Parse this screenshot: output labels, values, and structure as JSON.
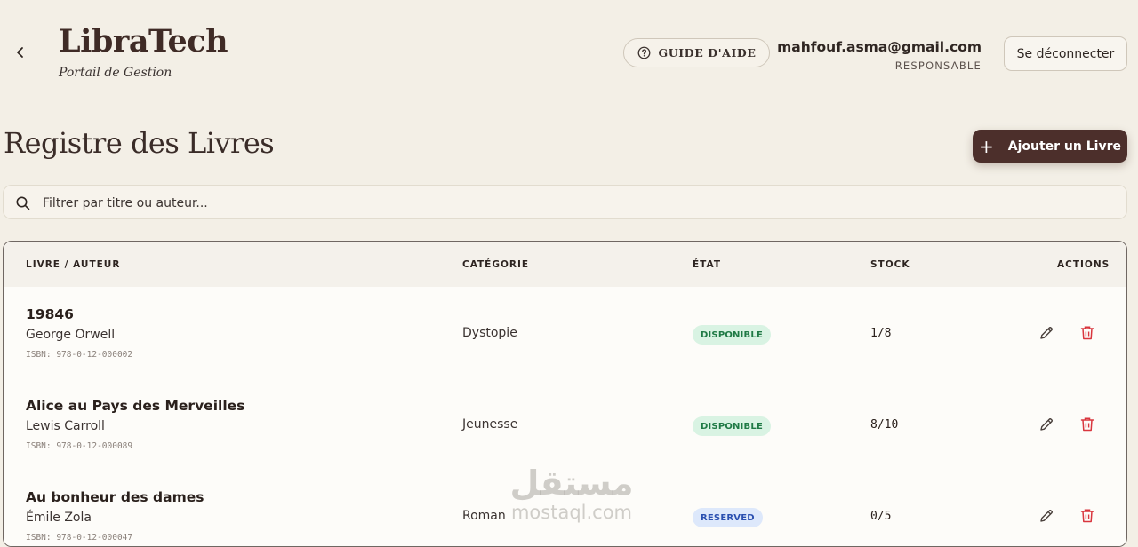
{
  "header": {
    "logo": "LibraTech",
    "subtitle": "Portail de Gestion",
    "guide_label": "GUIDE D'AIDE",
    "user_email": "mahfouf.asma@gmail.com",
    "user_role": "RESPONSABLE",
    "logout_label": "Se déconnecter"
  },
  "main": {
    "title": "Registre des Livres",
    "add_label": "Ajouter un Livre",
    "search_placeholder": "Filtrer par titre ou auteur..."
  },
  "table": {
    "headers": {
      "book": "LIVRE / AUTEUR",
      "category": "CATÉGORIE",
      "state": "ÉTAT",
      "stock": "STOCK",
      "actions": "ACTIONS"
    },
    "rows": [
      {
        "title": "19846",
        "author": "George Orwell",
        "isbn": "ISBN: 978-0-12-000002",
        "category": "Dystopie",
        "state": "DISPONIBLE",
        "stock": "1/8"
      },
      {
        "title": "Alice au Pays des Merveilles",
        "author": "Lewis Carroll",
        "isbn": "ISBN: 978-0-12-000089",
        "category": "Jeunesse",
        "state": "DISPONIBLE",
        "stock": "8/10"
      },
      {
        "title": "Au bonheur des dames",
        "author": "Émile Zola",
        "isbn": "ISBN: 978-0-12-000047",
        "category": "Roman",
        "state": "RESERVED",
        "stock": "0/5"
      }
    ]
  },
  "watermark": {
    "arabic": "مستقل",
    "latin": "mostaql.com"
  },
  "colors": {
    "background": "#f3efe6",
    "accent": "#4c2f2b",
    "available_bg": "#d9f3e3",
    "available_text": "#1f7a45",
    "reserved_bg": "#dde8fb",
    "reserved_text": "#2a4fb0",
    "delete": "#d9363e"
  },
  "icons": {
    "back": "chevron-left-icon",
    "guide": "help-circle-icon",
    "search": "search-icon",
    "add": "plus-icon",
    "edit": "pencil-icon",
    "delete": "trash-icon"
  }
}
